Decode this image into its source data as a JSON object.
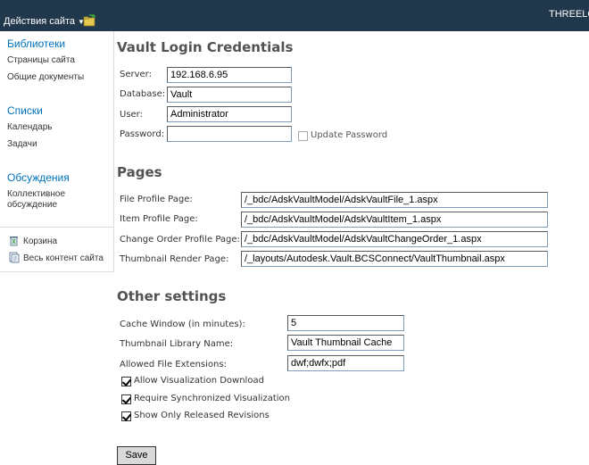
{
  "topbar": {
    "site_actions": "Действия сайта",
    "user": "THREELOG"
  },
  "nav": {
    "libraries": "Библиотеки",
    "site_pages": "Страницы сайта",
    "shared_docs": "Общие документы",
    "lists": "Списки",
    "calendar": "Календарь",
    "tasks": "Задачи",
    "discussions": "Обсуждения",
    "team_discussion": "Коллективное обсуждение",
    "recycle_bin": "Корзина",
    "all_content": "Весь контент сайта"
  },
  "login": {
    "title": "Vault Login Credentials",
    "server_label": "Server:",
    "server_value": "192.168.6.95",
    "database_label": "Database:",
    "database_value": "Vault",
    "user_label": "User:",
    "user_value": "Administrator",
    "password_label": "Password:",
    "password_value": "",
    "update_password": "Update Password"
  },
  "pages": {
    "title": "Pages",
    "file_profile_label": "File Profile Page:",
    "file_profile_value": "/_bdc/AdskVaultModel/AdskVaultFile_1.aspx",
    "item_profile_label": "Item Profile Page:",
    "item_profile_value": "/_bdc/AdskVaultModel/AdskVaultItem_1.aspx",
    "change_order_label": "Change Order Profile Page:",
    "change_order_value": "/_bdc/AdskVaultModel/AdskVaultChangeOrder_1.aspx",
    "thumbnail_render_label": "Thumbnail Render Page:",
    "thumbnail_render_value": "/_layouts/Autodesk.Vault.BCSConnect/VaultThumbnail.aspx"
  },
  "other": {
    "title": "Other settings",
    "cache_label": "Cache Window (in minutes):",
    "cache_value": "5",
    "thumb_lib_label": "Thumbnail Library Name:",
    "thumb_lib_value": "Vault Thumbnail Cache",
    "extensions_label": "Allowed File Extensions:",
    "extensions_value": "dwf;dwfx;pdf",
    "allow_download": "Allow Visualization Download",
    "require_sync": "Require Synchronized Visualization",
    "show_released": "Show Only Released Revisions",
    "allow_download_checked": true,
    "require_sync_checked": true,
    "show_released_checked": true,
    "update_password_checked": false
  },
  "buttons": {
    "save": "Save"
  },
  "colors": {
    "topbar": "#21374c",
    "nav_link": "#0072bc",
    "section_title": "#525252"
  }
}
